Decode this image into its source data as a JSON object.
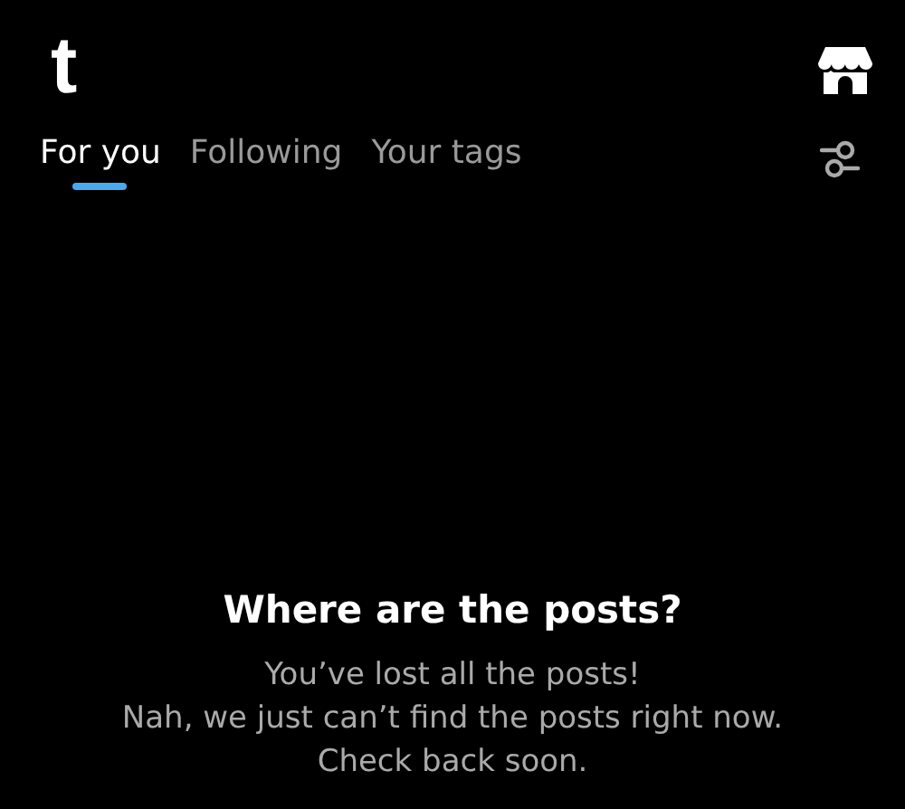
{
  "logo": "t",
  "tabs": [
    {
      "label": "For you",
      "selected": true
    },
    {
      "label": "Following",
      "selected": false
    },
    {
      "label": "Your tags",
      "selected": false
    }
  ],
  "empty_state": {
    "title": "Where are the posts?",
    "lines": [
      "You’ve lost all the posts!",
      "Nah, we just can’t find the posts right now.",
      "Check back soon."
    ]
  }
}
